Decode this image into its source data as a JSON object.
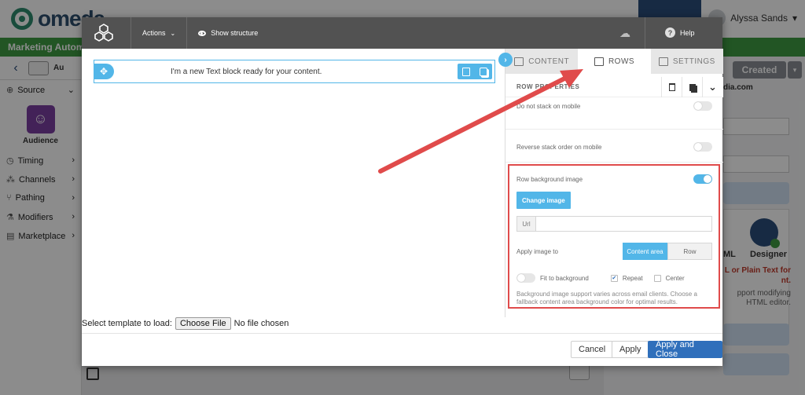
{
  "background": {
    "logo_text": "omeda",
    "user_name": "Alyssa Sands",
    "top_bar_title": "Marketing Automat",
    "sidebar": {
      "tools_text": "Au",
      "items": [
        {
          "label": "Source",
          "icon": "source-icon"
        },
        {
          "label": "Timing",
          "icon": "clock-icon"
        },
        {
          "label": "Channels",
          "icon": "channels-icon"
        },
        {
          "label": "Pathing",
          "icon": "pathing-icon"
        },
        {
          "label": "Modifiers",
          "icon": "modifiers-icon"
        },
        {
          "label": "Marketplace",
          "icon": "marketplace-icon"
        }
      ],
      "audience_label": "Audience"
    },
    "right": {
      "status": "Created",
      "email_domain": "dia.com",
      "designer_label": "Designer",
      "html_tag": "ML",
      "red_text": "L or Plain Text for nt.",
      "gray_text": "pport modifying HTML editor."
    }
  },
  "modal": {
    "toolbar": {
      "actions_label": "Actions",
      "structure_label": "Show structure",
      "help_label": "Help"
    },
    "canvas": {
      "text_block": "I'm a new Text block ready for your content."
    },
    "template": {
      "label": "Select template to load:",
      "file_button": "Choose File",
      "file_status": "No file chosen"
    },
    "footer": {
      "cancel": "Cancel",
      "apply": "Apply",
      "apply_close": "Apply and Close"
    },
    "panel": {
      "tabs": [
        {
          "label": "CONTENT",
          "icon": "grid-icon"
        },
        {
          "label": "ROWS",
          "icon": "rows-icon"
        },
        {
          "label": "SETTINGS",
          "icon": "settings-icon"
        }
      ],
      "active_tab": "ROWS",
      "properties_title": "ROW PROPERTIES",
      "do_not_stack": "Do not stack on mobile",
      "reverse_stack": "Reverse stack order on mobile",
      "row_bg_image": "Row background image",
      "row_bg_enabled": true,
      "change_image": "Change image",
      "url_label": "Url",
      "url_value": "",
      "apply_image_to": "Apply image to",
      "apply_options": [
        "Content area",
        "Row"
      ],
      "apply_selected": "Content area",
      "fit_to_background": "Fit to background",
      "repeat": "Repeat",
      "repeat_checked": true,
      "center": "Center",
      "center_checked": false,
      "note": "Background image support varies across email clients. Choose a fallback content area background color for optimal results."
    }
  },
  "colors": {
    "accent": "#52b6e8",
    "primary_button": "#2f6fbb",
    "highlight_box": "#e04b4b",
    "toolbar": "#525252"
  }
}
